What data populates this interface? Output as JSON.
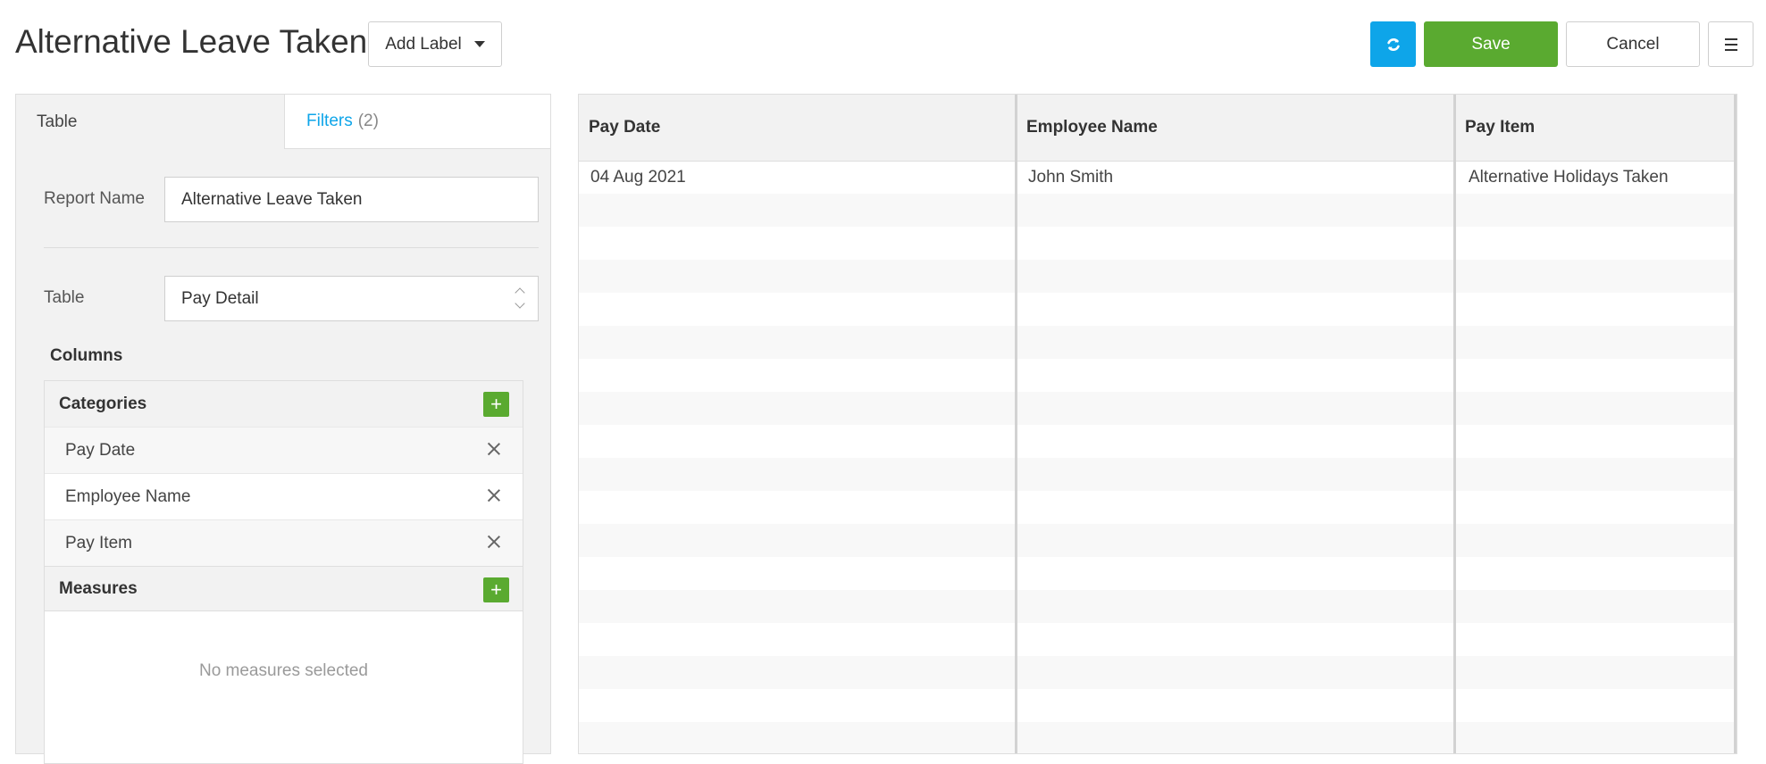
{
  "header": {
    "title": "Alternative Leave Taken",
    "add_label": "Add Label",
    "save_label": "Save",
    "cancel_label": "Cancel"
  },
  "colors": {
    "accent": "#0ea5e9",
    "save": "#5aaa30",
    "add": "#5aaa30"
  },
  "tabs": {
    "table": "Table",
    "filters": "Filters",
    "filters_count": "(2)"
  },
  "form": {
    "report_name_label": "Report Name",
    "report_name_value": "Alternative Leave Taken",
    "table_label": "Table",
    "table_value": "Pay Detail",
    "columns_heading": "Columns"
  },
  "categories": {
    "heading": "Categories",
    "items": [
      "Pay Date",
      "Employee Name",
      "Pay Item"
    ]
  },
  "measures": {
    "heading": "Measures",
    "empty": "No measures selected"
  },
  "grid": {
    "columns": [
      "Pay Date",
      "Employee Name",
      "Pay Item"
    ],
    "rows": [
      [
        "04 Aug 2021",
        "John Smith",
        "Alternative Holidays Taken"
      ]
    ]
  },
  "icons": {
    "refresh": "refresh-icon",
    "menu": "hamburger-menu-icon",
    "caret": "caret-down-icon",
    "add": "plus-icon",
    "remove": "close-icon",
    "select": "select-arrows-icon"
  }
}
